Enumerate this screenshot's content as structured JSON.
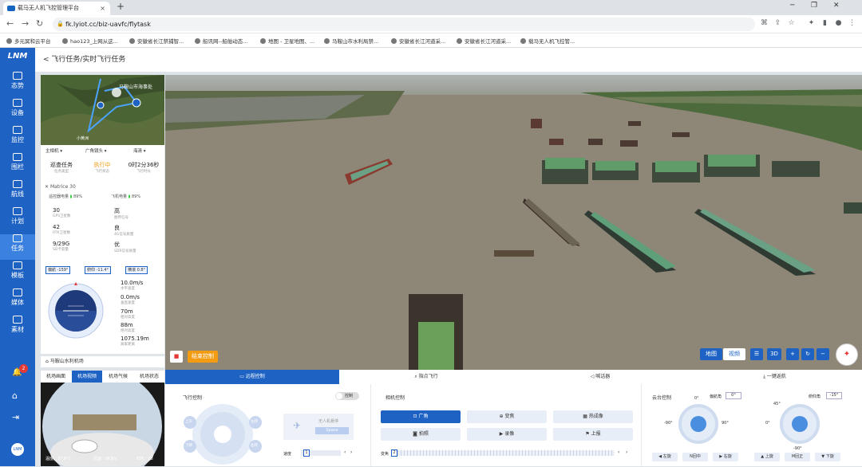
{
  "browser": {
    "tab_title": "载马无人机飞控管理平台",
    "new_tab": "+",
    "url": "fk.lyiot.cc/biz-uavfc/flytask",
    "bookmarks": [
      "多元冥和云平台",
      "hao123_上网从这...",
      "安徽省长江禁捕智...",
      "船讯网--船舶动态...",
      "地图 - 卫星地图、...",
      "马鞍山市水利局禁...",
      "安徽省长江河道采...",
      "安徽省长江河道采...",
      "载马无人机飞控管..."
    ]
  },
  "sidebar": {
    "logo": "LNM",
    "items": [
      {
        "label": "态势",
        "icon": "situation-icon"
      },
      {
        "label": "设备",
        "icon": "device-icon"
      },
      {
        "label": "监控",
        "icon": "monitor-icon"
      },
      {
        "label": "围栏",
        "icon": "fence-icon"
      },
      {
        "label": "航线",
        "icon": "route-icon"
      },
      {
        "label": "计划",
        "icon": "plan-icon"
      },
      {
        "label": "任务",
        "icon": "task-icon"
      },
      {
        "label": "模板",
        "icon": "template-icon"
      },
      {
        "label": "媒体",
        "icon": "media-icon"
      },
      {
        "label": "素材",
        "icon": "material-icon"
      }
    ],
    "notif_count": "2"
  },
  "page": {
    "breadcrumb": "< 飞行任务/实时飞行任务"
  },
  "map_mini": {
    "label": "马鞍山市海事处",
    "label2": "小黄洲"
  },
  "panel": {
    "dropdowns": [
      "主相机",
      "广角镜头",
      "海清"
    ],
    "status": [
      {
        "value": "巡查任务",
        "label": "任务类型"
      },
      {
        "value": "执行中",
        "label": "飞行状态"
      },
      {
        "value": "0时2分36秒",
        "label": "飞行时长"
      }
    ],
    "drone_model": "Matrice 30",
    "battery_remote_label": "遥控器电量",
    "battery_remote": "89%",
    "battery_drone_label": "飞机电量",
    "battery_drone": "89%",
    "tele": [
      {
        "value": "30",
        "label": "GPS卫星数"
      },
      {
        "value": "高",
        "label": "图传信号"
      },
      {
        "value": "42",
        "label": "RTK卫星数"
      },
      {
        "value": "良",
        "label": "4G信号质量"
      },
      {
        "value": "9/29G",
        "label": "SD卡容量"
      },
      {
        "value": "优",
        "label": "SDR信号质量"
      }
    ],
    "pills": [
      "偏航 -159°",
      "俯仰 -11.4°",
      "横滚 0.8°"
    ],
    "flight": [
      {
        "value": "10.0m/s",
        "label": "水平速度"
      },
      {
        "value": "0.0m/s",
        "label": "垂直速度"
      },
      {
        "value": "70m",
        "label": "相对高度"
      },
      {
        "value": "88m",
        "label": "绝对高度"
      },
      {
        "value": "1075.19m",
        "label": "离家距离"
      }
    ],
    "airport": "马鞍山水利机场"
  },
  "cam_tabs": [
    "机场画面",
    "机场视频",
    "机场气候",
    "机场状态"
  ],
  "fisheye_info": {
    "temp": "温度：37.6°C",
    "wind": "风速：0KB/s",
    "rtk": "RTK：28"
  },
  "video_overlay": {
    "stop": "结束控制",
    "map": "地图",
    "video": "视频",
    "three_d": "3D"
  },
  "bottom_tabs": [
    "远程控制",
    "指点飞行",
    "喊话器",
    "一键返航"
  ],
  "controls": {
    "flight_ctrl": "飞行控制",
    "toggle": "控制",
    "joystick": [
      "上升",
      "下降",
      "左转",
      "右转",
      "前进",
      "后退",
      "左移",
      "右移"
    ],
    "drone_status": "无人机悬停",
    "space": "Space",
    "speed_label": "速度",
    "speed_val": "1",
    "camera_ctrl": "相机控制",
    "cam_buttons": [
      "广角",
      "变焦",
      "热成像",
      "拍照",
      "录像",
      "上报"
    ],
    "zoom_label": "变焦",
    "zoom_val": "2",
    "gimbal_ctrl": "云台控制",
    "yaw_label": "偏航角",
    "yaw_val": "0°",
    "pitch_label": "俯仰角",
    "pitch_val": "-15°",
    "dial_yaw": [
      "0°",
      "-90°",
      "90°"
    ],
    "dial_pitch": [
      "45°",
      "0°",
      "-90°"
    ],
    "gimbal_buttons": [
      "左旋",
      "N回中",
      "右旋",
      "上旋",
      "M回正",
      "下旋"
    ]
  }
}
